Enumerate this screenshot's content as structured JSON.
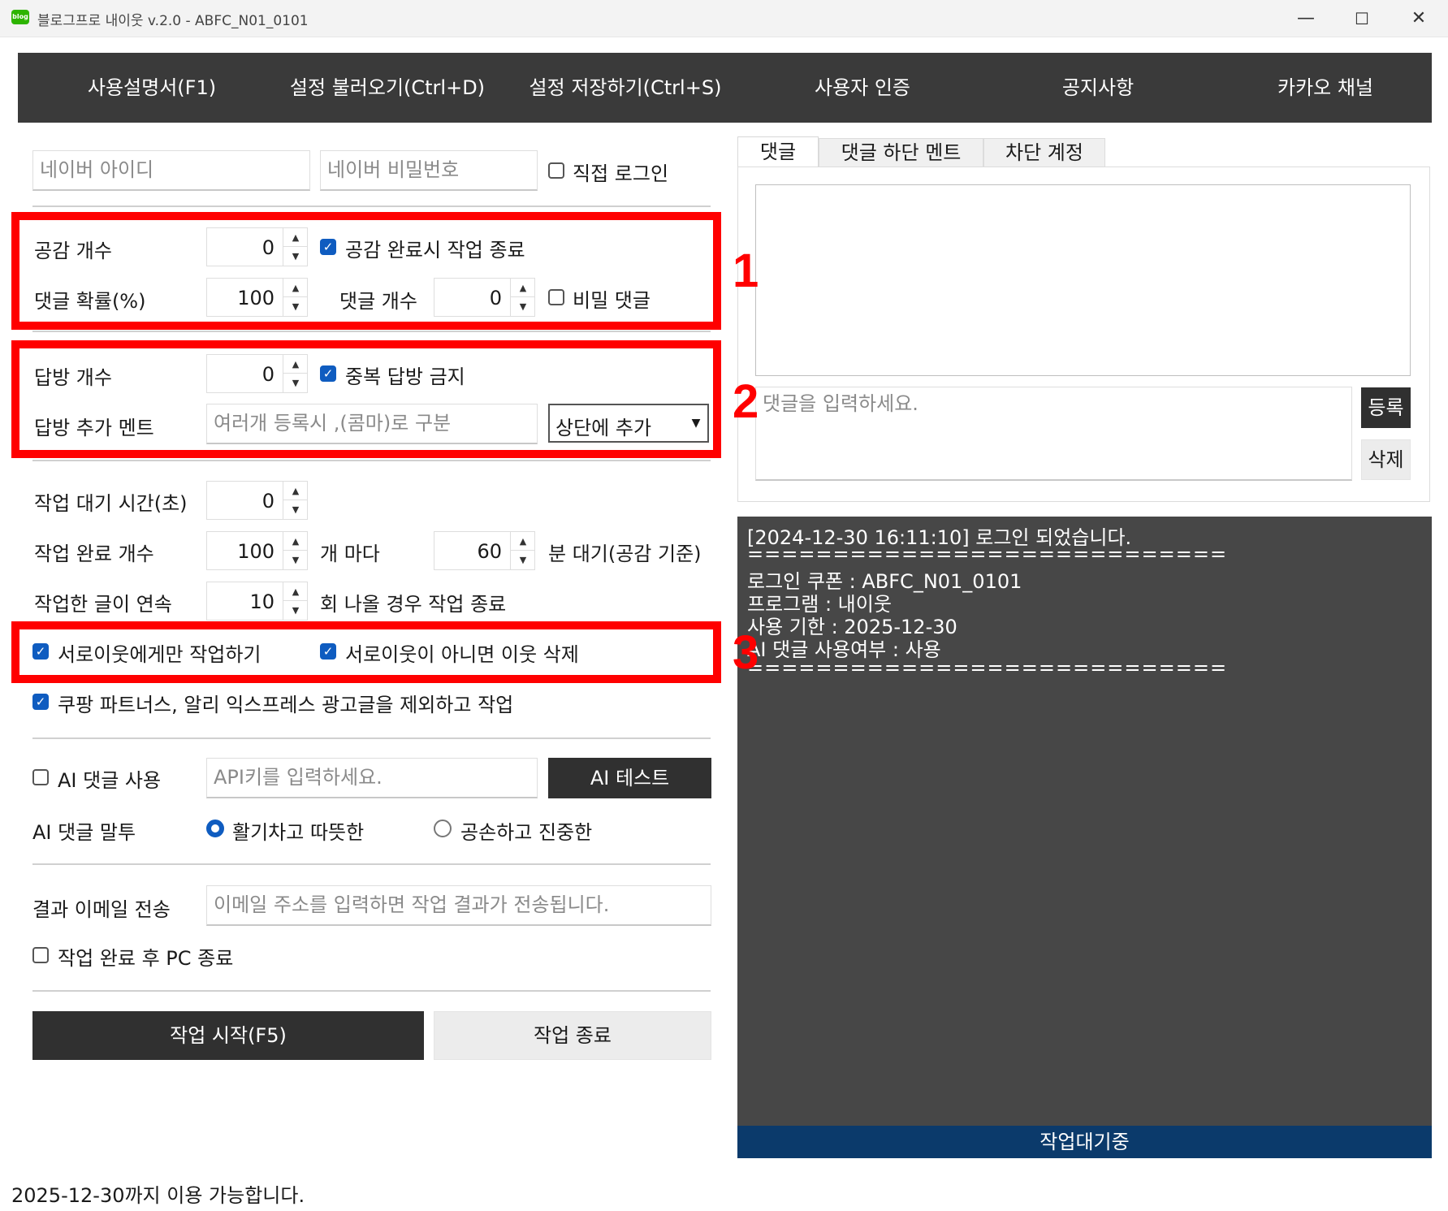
{
  "window": {
    "app_icon": "blog",
    "title": "블로그프로 내이웃 v.2.0 - ABFC_N01_0101",
    "minimize": "—",
    "maximize": "☐",
    "close": "✕"
  },
  "menu": [
    "사용설명서(F1)",
    "설정 불러오기(Ctrl+D)",
    "설정 저장하기(Ctrl+S)",
    "사용자 인증",
    "공지사항",
    "카카오 채널"
  ],
  "login": {
    "id_placeholder": "네이버 아이디",
    "pw_placeholder": "네이버 비밀번호",
    "direct_login": "직접 로그인"
  },
  "like": {
    "count_label": "공감 개수",
    "count_value": "0",
    "stop_on_complete": "공감 완료시 작업 종료"
  },
  "comment": {
    "prob_label": "댓글 확률(%)",
    "prob_value": "100",
    "count_label": "댓글 개수",
    "count_value": "0",
    "secret": "비밀 댓글"
  },
  "guestbook": {
    "count_label": "답방 개수",
    "count_value": "0",
    "no_dup": "중복 답방 금지",
    "ment_label": "답방 추가 멘트",
    "ment_placeholder": "여러개 등록시 ,(콤마)로 구분",
    "position": "상단에 추가"
  },
  "wait": {
    "label": "작업 대기 시간(초)",
    "value": "0"
  },
  "complete": {
    "label": "작업 완료 개수",
    "value": "100",
    "per": "개 마다",
    "minutes": "60",
    "minutes_label": "분 대기(공감 기준)"
  },
  "consecutive": {
    "label": "작업한 글이 연속",
    "value": "10",
    "suffix": "회 나올 경우 작업 종료"
  },
  "mutual": {
    "only_mutual": "서로이웃에게만 작업하기",
    "delete_non_mutual": "서로이웃이 아니면 이웃 삭제",
    "exclude_ads": "쿠팡 파트너스, 알리 익스프레스 광고글을 제외하고 작업"
  },
  "ai": {
    "use_label": "AI 댓글 사용",
    "key_placeholder": "API키를 입력하세요.",
    "test_button": "AI 테스트",
    "tone_label": "AI 댓글 말투",
    "tone_lively": "활기차고 따뜻한",
    "tone_polite": "공손하고 진중한"
  },
  "email": {
    "label": "결과 이메일 전송",
    "placeholder": "이메일 주소를 입력하면 작업 결과가 전송됩니다."
  },
  "shutdown": "작업 완료 후 PC 종료",
  "buttons": {
    "start": "작업 시작(F5)",
    "stop": "작업 종료"
  },
  "footer": "2025-12-30까지 이용 가능합니다.",
  "tabs": [
    "댓글",
    "댓글 하단 멘트",
    "차단 계정"
  ],
  "comment_panel": {
    "input_placeholder": "댓글을 입력하세요.",
    "register": "등록",
    "delete": "삭제"
  },
  "log": [
    "[2024-12-30 16:11:10] 로그인 되었습니다.",
    "============================",
    "로그인 쿠폰 : ABFC_N01_0101",
    "프로그램 : 내이웃",
    "사용 기한 : 2025-12-30",
    "AI 댓글 사용여부 : 사용",
    "============================"
  ],
  "status": "작업대기중",
  "annotations": [
    "1",
    "2",
    "3"
  ],
  "colors": {
    "menu_bg": "#3a3a3a",
    "accent_blue": "#0f5cc0",
    "annotation_red": "#ff0000",
    "log_bg": "#474747",
    "status_bg": "#0b3a6b"
  }
}
